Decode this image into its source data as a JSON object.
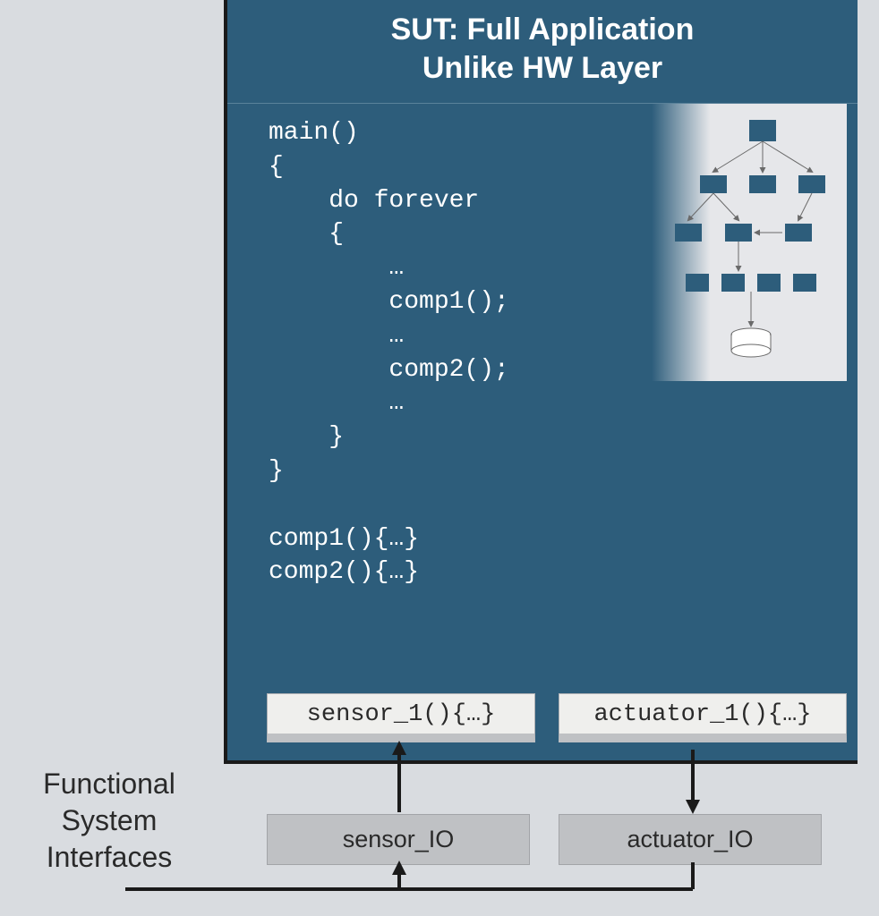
{
  "sut": {
    "title_line1": "SUT: Full Application",
    "title_line2": "Unlike HW Layer",
    "code": "main()\n{\n    do forever\n    {\n        …\n        comp1();\n        …\n        comp2();\n        …\n    }\n}\n\ncomp1(){…}\ncomp2(){…}",
    "sensor_fn": "sensor_1(){…}",
    "actuator_fn": "actuator_1(){…}"
  },
  "io": {
    "sensor": "sensor_IO",
    "actuator": "actuator_IO"
  },
  "label": {
    "fsi_line1": "Functional",
    "fsi_line2": "System",
    "fsi_line3": "Interfaces"
  },
  "colors": {
    "panel": "#2d5d7b",
    "bg": "#d9dce0",
    "fnbox": "#efefed",
    "iobox": "#bfc1c4"
  }
}
